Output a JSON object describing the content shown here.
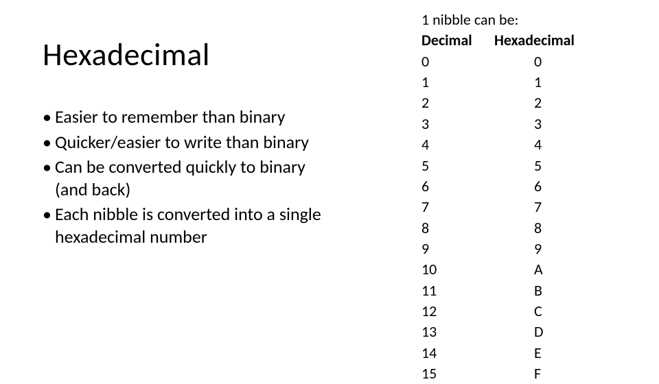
{
  "title": "Hexadecimal",
  "bullets": [
    "Easier to remember than binary",
    "Quicker/easier to write than binary",
    "Can be converted quickly to binary (and back)",
    "Each nibble is converted into a single hexadecimal number"
  ],
  "table": {
    "title": "1 nibble can be:",
    "header_decimal": "Decimal",
    "header_hex": "Hexadecimal",
    "rows": [
      {
        "dec": "0",
        "hex": "0"
      },
      {
        "dec": "1",
        "hex": "1"
      },
      {
        "dec": "2",
        "hex": "2"
      },
      {
        "dec": "3",
        "hex": "3"
      },
      {
        "dec": "4",
        "hex": "4"
      },
      {
        "dec": "5",
        "hex": "5"
      },
      {
        "dec": "6",
        "hex": "6"
      },
      {
        "dec": "7",
        "hex": "7"
      },
      {
        "dec": "8",
        "hex": "8"
      },
      {
        "dec": "9",
        "hex": "9"
      },
      {
        "dec": "10",
        "hex": "A"
      },
      {
        "dec": "11",
        "hex": "B"
      },
      {
        "dec": "12",
        "hex": "C"
      },
      {
        "dec": "13",
        "hex": "D"
      },
      {
        "dec": "14",
        "hex": "E"
      },
      {
        "dec": "15",
        "hex": "F"
      }
    ]
  }
}
